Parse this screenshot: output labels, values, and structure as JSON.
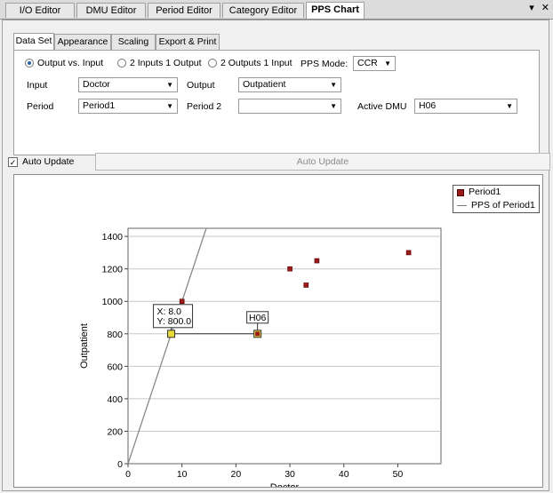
{
  "doc_tabs": [
    "I/O Editor",
    "DMU Editor",
    "Period Editor",
    "Category Editor",
    "PPS Chart"
  ],
  "active_doc_tab": "PPS Chart",
  "tab_controls": {
    "dropdown_icon": "chevron-down-icon",
    "close_icon": "close-icon",
    "dropdown": "▾",
    "close": "✕"
  },
  "inner_tabs": [
    "Data Set",
    "Appearance",
    "Scaling",
    "Export & Print"
  ],
  "active_inner_tab": "Data Set",
  "mode": {
    "options": [
      "Output vs. Input",
      "2 Inputs 1 Output",
      "2 Outputs 1 Input"
    ],
    "selected": "Output vs. Input",
    "pps_mode_label": "PPS Mode:",
    "pps_mode_value": "CCR"
  },
  "fields": {
    "input_label": "Input",
    "input_value": "Doctor",
    "output_label": "Output",
    "output_value": "Outpatient",
    "period_label": "Period",
    "period_value": "Period1",
    "period2_label": "Period 2",
    "period2_value": "",
    "active_dmu_label": "Active DMU",
    "active_dmu_value": "H06"
  },
  "auto_update": {
    "checked": true,
    "check_label": "Auto Update",
    "button_label": "Auto Update"
  },
  "colors": {
    "points": "#9b1b1b",
    "frontier": "#8a8a8a",
    "highlight": "#e8d93a"
  },
  "chart_data": {
    "type": "scatter",
    "xlabel": "Doctor",
    "ylabel": "Outpatient",
    "xlim": [
      0,
      58
    ],
    "ylim": [
      0,
      1450
    ],
    "xticks": [
      0,
      10,
      20,
      30,
      40,
      50
    ],
    "yticks": [
      0,
      200,
      400,
      600,
      800,
      1000,
      1200,
      1400
    ],
    "grid": "horizontal",
    "legend_position": "top-right",
    "series": [
      {
        "name": "Period1",
        "type": "scatter",
        "x": [
          8,
          10,
          24,
          30,
          33,
          35,
          52
        ],
        "y": [
          800,
          1000,
          800,
          1200,
          1100,
          1250,
          1300
        ]
      },
      {
        "name": "PPS of Period1",
        "type": "line",
        "x": [
          0,
          14.5
        ],
        "y": [
          0,
          1450
        ]
      }
    ],
    "annotations": [
      {
        "text": "X: 8.0",
        "text2": "Y: 800.0",
        "x": 8,
        "y": 800
      },
      {
        "text": "H06",
        "x": 24,
        "y": 800
      }
    ]
  }
}
